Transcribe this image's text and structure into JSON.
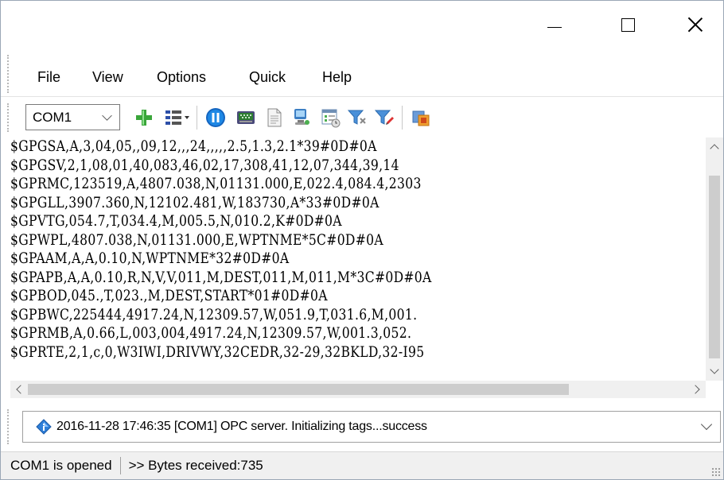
{
  "window": {
    "controls": {
      "minimize": "minimize",
      "maximize": "maximize",
      "close": "close"
    }
  },
  "menu": {
    "items": [
      {
        "label": "File"
      },
      {
        "label": "View"
      },
      {
        "label": "Options"
      },
      {
        "label": "Quick"
      },
      {
        "label": "Help"
      }
    ]
  },
  "toolbar": {
    "port": {
      "selected": "COM1"
    },
    "icons": [
      "add-icon",
      "list-settings-icon",
      "pause-icon",
      "serial-port-icon",
      "document-icon",
      "monitor-icon",
      "log-view-icon",
      "filter-icon",
      "filter-edit-icon",
      "plugin-icon"
    ]
  },
  "log": {
    "lines": [
      "$GPGSA,A,3,04,05,,09,12,,,24,,,,,2.5,1.3,2.1*39#0D#0A",
      "$GPGSV,2,1,08,01,40,083,46,02,17,308,41,12,07,344,39,14",
      "$GPRMC,123519,A,4807.038,N,01131.000,E,022.4,084.4,2303",
      "$GPGLL,3907.360,N,12102.481,W,183730,A*33#0D#0A",
      "$GPVTG,054.7,T,034.4,M,005.5,N,010.2,K#0D#0A",
      "$GPWPL,4807.038,N,01131.000,E,WPTNME*5C#0D#0A",
      "$GPAAM,A,A,0.10,N,WPTNME*32#0D#0A",
      "$GPAPB,A,A,0.10,R,N,V,V,011,M,DEST,011,M,011,M*3C#0D#0A",
      "$GPBOD,045.,T,023.,M,DEST,START*01#0D#0A",
      "$GPBWC,225444,4917.24,N,12309.57,W,051.9,T,031.6,M,001.",
      "$GPRMB,A,0.66,L,003,004,4917.24,N,12309.57,W,001.3,052.",
      "$GPRTE,2,1,c,0,W3IWI,DRIVWY,32CEDR,32-29,32BKLD,32-I95"
    ]
  },
  "event": {
    "text": "2016-11-28 17:46:35 [COM1] OPC server. Initializing tags...success"
  },
  "status": {
    "port_state": "COM1 is opened",
    "bytes": ">> Bytes received:735"
  }
}
